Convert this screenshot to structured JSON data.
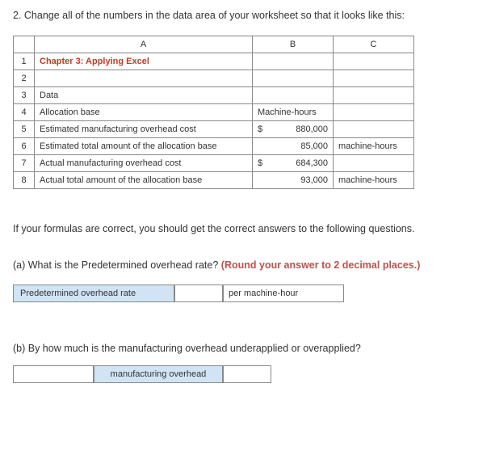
{
  "instruction": "2. Change all of the numbers in the data area of your worksheet so that it looks like this:",
  "sheet": {
    "headers": {
      "a": "A",
      "b": "B",
      "c": "C"
    },
    "rows": [
      {
        "n": "1",
        "a": "Chapter 3: Applying Excel",
        "b": "",
        "c": ""
      },
      {
        "n": "2",
        "a": "",
        "b": "",
        "c": ""
      },
      {
        "n": "3",
        "a": "Data",
        "b": "",
        "c": ""
      },
      {
        "n": "4",
        "a": "Allocation base",
        "b": "Machine-hours",
        "c": ""
      },
      {
        "n": "5",
        "a": "Estimated manufacturing overhead cost",
        "b_sym": "$",
        "b_val": "880,000",
        "c": ""
      },
      {
        "n": "6",
        "a": "Estimated total amount of the allocation base",
        "b_val": "85,000",
        "c": "machine-hours"
      },
      {
        "n": "7",
        "a": "Actual manufacturing overhead cost",
        "b_sym": "$",
        "b_val": "684,300",
        "c": ""
      },
      {
        "n": "8",
        "a": "Actual total amount of the allocation base",
        "b_val": "93,000",
        "c": "machine-hours"
      }
    ]
  },
  "para1": "If your formulas are correct, you should get the correct answers to the following questions.",
  "qa": {
    "prompt_pre": "(a) What is the Predetermined overhead rate? ",
    "prompt_red": "(Round your answer to 2 decimal places.)",
    "label": "Predetermined overhead rate",
    "unit": "per machine-hour"
  },
  "qb": {
    "prompt": "(b) By how much is the manufacturing overhead underapplied or overapplied?",
    "label": "manufacturing overhead"
  }
}
